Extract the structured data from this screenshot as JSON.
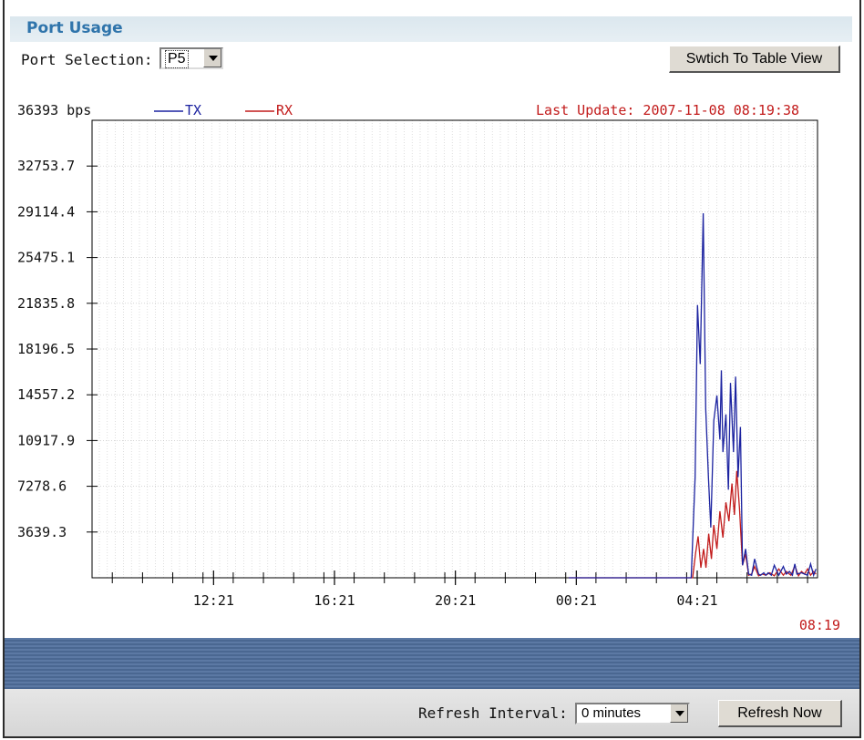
{
  "panel": {
    "title": "Port Usage"
  },
  "port_selection": {
    "label": "Port Selection:",
    "value": "P5"
  },
  "switch_button": {
    "label": "Swtich To Table View"
  },
  "legend": {
    "tx": "TX",
    "rx": "RX"
  },
  "colors": {
    "tx": "#1c23a0",
    "rx": "#c21b1b",
    "title": "#2f74ab",
    "band": "#4f6b96"
  },
  "last_update": "Last Update: 2007-11-08 08:19:38",
  "current_time_label": "08:19",
  "refresh": {
    "label": "Refresh Interval:",
    "value": "0 minutes",
    "button": "Refresh Now"
  },
  "chart_data": {
    "type": "line",
    "top_label": "36393 bps",
    "yticks": [
      3639.3,
      7278.6,
      10917.9,
      14557.2,
      18196.5,
      21835.8,
      25475.1,
      29114.4,
      32753.7
    ],
    "ytick_labels": [
      "3639.3",
      "7278.6",
      "10917.9",
      "14557.2",
      "18196.5",
      "21835.8",
      "25475.1",
      "29114.4",
      "32753.7"
    ],
    "ylim": [
      0,
      36393
    ],
    "xtick_labels": [
      "12:21",
      "16:21",
      "20:21",
      "00:21",
      "04:21"
    ],
    "x_hours_range": [
      8.33,
      32.33
    ],
    "xtick_hours": [
      12.35,
      16.35,
      20.35,
      24.35,
      28.35
    ],
    "grid": true,
    "series": [
      {
        "name": "TX",
        "x": [
          24.1,
          26.0,
          28.15,
          28.28,
          28.36,
          28.45,
          28.55,
          28.63,
          28.72,
          28.8,
          28.9,
          29.0,
          29.1,
          29.15,
          29.2,
          29.3,
          29.38,
          29.45,
          29.55,
          29.62,
          29.7,
          29.78,
          29.85,
          29.95,
          30.05,
          30.15,
          30.25,
          30.38,
          30.45,
          30.55,
          30.62,
          30.7,
          30.8,
          30.9,
          31.05,
          31.2,
          31.3,
          31.4,
          31.5,
          31.58,
          31.65,
          31.8,
          31.9,
          32.0,
          32.1,
          32.2,
          32.28
        ],
        "values": [
          0,
          0,
          0,
          8000,
          21700,
          17000,
          29000,
          13500,
          8000,
          4000,
          12500,
          14500,
          11000,
          16500,
          10000,
          13000,
          7000,
          15500,
          10000,
          16000,
          8000,
          12000,
          1000,
          2300,
          300,
          200,
          1500,
          300,
          200,
          400,
          200,
          400,
          200,
          1000,
          200,
          900,
          300,
          500,
          200,
          1100,
          300,
          400,
          300,
          200,
          1100,
          200,
          700
        ]
      },
      {
        "name": "RX",
        "x": [
          24.1,
          26.0,
          28.2,
          28.3,
          28.38,
          28.47,
          28.56,
          28.64,
          28.73,
          28.82,
          28.9,
          29.0,
          29.1,
          29.2,
          29.3,
          29.4,
          29.5,
          29.58,
          29.66,
          29.75,
          29.85,
          29.95,
          30.05,
          30.15,
          30.25,
          30.38,
          30.5,
          30.62,
          30.75,
          30.9,
          31.05,
          31.2,
          31.3,
          31.45,
          31.58,
          31.7,
          31.8,
          31.9,
          32.0,
          32.1,
          32.2,
          32.28
        ],
        "values": [
          0,
          0,
          0,
          2000,
          3300,
          800,
          2300,
          800,
          3500,
          1500,
          4200,
          2300,
          5300,
          3200,
          6000,
          4500,
          7500,
          5000,
          8500,
          5500,
          1000,
          1900,
          200,
          300,
          900,
          150,
          300,
          200,
          400,
          150,
          700,
          200,
          500,
          200,
          950,
          150,
          500,
          300,
          700,
          200,
          500,
          300
        ]
      }
    ]
  }
}
